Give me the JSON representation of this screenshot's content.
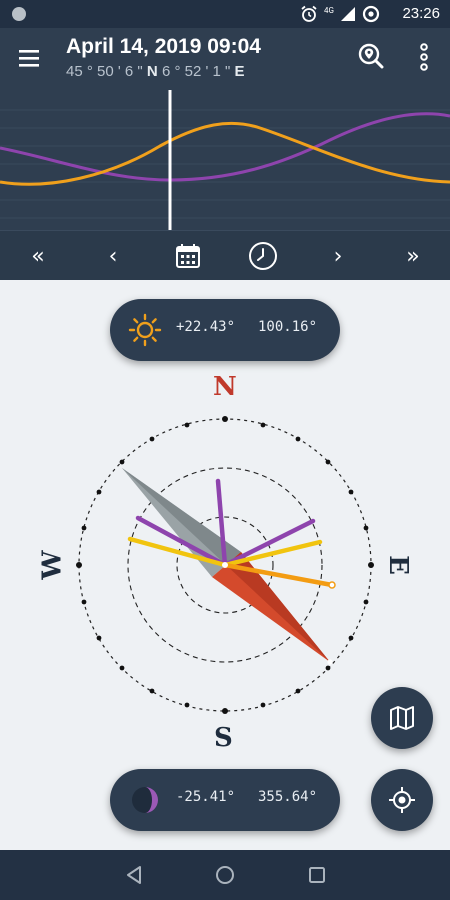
{
  "status_bar": {
    "time": "23:26",
    "network": "4G",
    "icons": [
      "alarm-icon",
      "signal-icon",
      "data-saver-icon"
    ]
  },
  "header": {
    "title": "April 14, 2019 09:04",
    "coords_lat": "45 ° 50 ' 6 \"",
    "coords_lat_dir": "N",
    "coords_lon": "6 ° 52 ' 1 \"",
    "coords_lon_dir": "E"
  },
  "timeline": {
    "sun_color": "#f0a01c",
    "moon_color": "#8e44ad",
    "current_marker_color": "#ffffff"
  },
  "controls": {
    "fast_back": "«",
    "back": "‹",
    "forward": "›",
    "fast_forward": "»",
    "calendar_icon": "calendar-icon",
    "clock_icon": "clock-icon"
  },
  "sun": {
    "elevation": "+22.43°",
    "azimuth": "100.16°",
    "color": "#f0a01c"
  },
  "moon": {
    "elevation": "-25.41°",
    "azimuth": "355.64°",
    "color": "#8e44ad"
  },
  "compass": {
    "north": "N",
    "south": "S",
    "east": "E",
    "west": "W",
    "north_color": "#c0392b"
  },
  "fabs": {
    "map_icon": "map-icon",
    "location_icon": "my-location-icon"
  },
  "nav": {
    "back_icon": "back-icon",
    "home_icon": "home-icon",
    "recents_icon": "recents-icon"
  }
}
